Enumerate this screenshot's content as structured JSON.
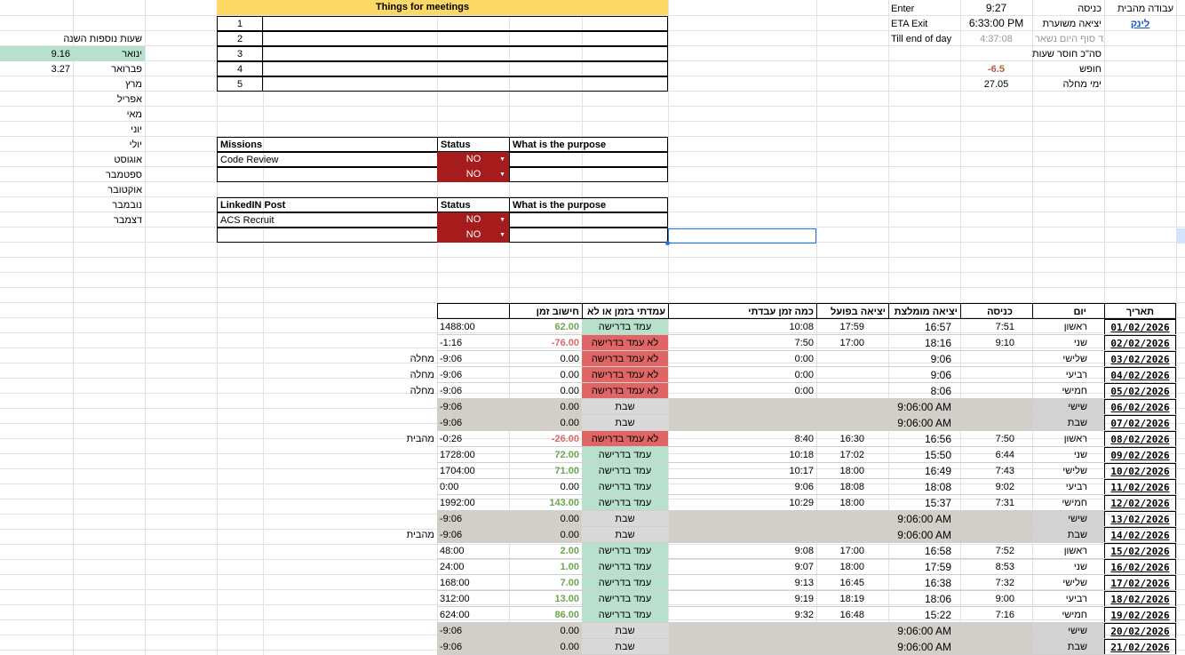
{
  "top_right": {
    "title": "עבודה מהבית",
    "link": "לינק",
    "labels": [
      "כניסה",
      "יציאה משוערת",
      "עד סוף היום נשאר",
      "סה\"כ חוסר שעות",
      "חופש",
      "ימי מחלה"
    ],
    "values": [
      "9:27",
      "6:33:00 PM",
      "4:37:08",
      "",
      "-6.5",
      "27.05"
    ],
    "english": [
      "Enter",
      "ETA Exit",
      "Till end of day"
    ]
  },
  "extra_hours": {
    "title": "שעות נוספות השנה",
    "months": [
      "ינואר",
      "פברואר",
      "מרץ",
      "אפריל",
      "מאי",
      "יוני",
      "יולי",
      "אוגוסט",
      "ספטמבר",
      "אוקטובר",
      "נובמבר",
      "דצמבר"
    ],
    "values": [
      "9.16",
      "3.27",
      "",
      "",
      "",
      "",
      "",
      "",
      "",
      "",
      "",
      ""
    ]
  },
  "meetings": {
    "title": "Things for meetings",
    "numbers": [
      "1",
      "2",
      "3",
      "4",
      "5"
    ]
  },
  "missions": {
    "headers": [
      "Missions",
      "Status",
      "What is the purpose"
    ],
    "rows": [
      {
        "name": "Code Review",
        "status": "NO"
      },
      {
        "name": "",
        "status": "NO"
      }
    ]
  },
  "linkedin": {
    "headers": [
      "LinkedIN Post",
      "Status",
      "What is the purpose"
    ],
    "rows": [
      {
        "name": "ACS Recruit",
        "status": "NO"
      },
      {
        "name": "",
        "status": "NO"
      }
    ]
  },
  "log": {
    "headers": [
      "תאריך",
      "יום",
      "כניסה",
      "יציאה מומלצת",
      "יציאה בפועל",
      "כמה זמן עבדתי",
      "עמדתי בזמן או לא",
      "חישוב זמן",
      ""
    ],
    "rows": [
      {
        "date": "01/02/2026",
        "day": "ראשון",
        "enter": "7:51",
        "rec": "16:57",
        "actual": "17:59",
        "worked": "10:08",
        "status": "עמד בדרישה",
        "calc": "62.00",
        "total": "1488:00",
        "note": "",
        "type": "ok"
      },
      {
        "date": "02/02/2026",
        "day": "שני",
        "enter": "9:10",
        "rec": "18:16",
        "actual": "17:00",
        "worked": "7:50",
        "status": "לא עמד בדרישה",
        "calc": "-76.00",
        "total": "-1:16",
        "note": "",
        "type": "bad"
      },
      {
        "date": "03/02/2026",
        "day": "שלישי",
        "enter": "",
        "rec": "9:06",
        "actual": "",
        "worked": "0:00",
        "status": "לא עמד בדרישה",
        "calc": "0.00",
        "total": "-9:06",
        "note": "מחלה",
        "type": "bad"
      },
      {
        "date": "04/02/2026",
        "day": "רביעי",
        "enter": "",
        "rec": "9:06",
        "actual": "",
        "worked": "0:00",
        "status": "לא עמד בדרישה",
        "calc": "0.00",
        "total": "-9:06",
        "note": "מחלה",
        "type": "bad"
      },
      {
        "date": "05/02/2026",
        "day": "חמישי",
        "enter": "",
        "rec": "8:06",
        "actual": "",
        "worked": "0:00",
        "status": "לא עמד בדרישה",
        "calc": "0.00",
        "total": "-9:06",
        "note": "מחלה",
        "type": "bad"
      },
      {
        "date": "06/02/2026",
        "day": "שישי",
        "enter": "",
        "rec": "9:06:00 AM",
        "actual": "",
        "worked": "",
        "status": "שבת",
        "calc": "0.00",
        "total": "-9:06",
        "note": "",
        "type": "weekend"
      },
      {
        "date": "07/02/2026",
        "day": "שבת",
        "enter": "",
        "rec": "9:06:00 AM",
        "actual": "",
        "worked": "",
        "status": "שבת",
        "calc": "0.00",
        "total": "-9:06",
        "note": "",
        "type": "weekend"
      },
      {
        "date": "08/02/2026",
        "day": "ראשון",
        "enter": "7:50",
        "rec": "16:56",
        "actual": "16:30",
        "worked": "8:40",
        "status": "לא עמד בדרישה",
        "calc": "-26.00",
        "total": "-0:26",
        "note": "מהבית",
        "type": "bad"
      },
      {
        "date": "09/02/2026",
        "day": "שני",
        "enter": "6:44",
        "rec": "15:50",
        "actual": "17:02",
        "worked": "10:18",
        "status": "עמד בדרישה",
        "calc": "72.00",
        "total": "1728:00",
        "note": "",
        "type": "ok"
      },
      {
        "date": "10/02/2026",
        "day": "שלישי",
        "enter": "7:43",
        "rec": "16:49",
        "actual": "18:00",
        "worked": "10:17",
        "status": "עמד בדרישה",
        "calc": "71.00",
        "total": "1704:00",
        "note": "",
        "type": "ok"
      },
      {
        "date": "11/02/2026",
        "day": "רביעי",
        "enter": "9:02",
        "rec": "18:08",
        "actual": "18:08",
        "worked": "9:06",
        "status": "עמד בדרישה",
        "calc": "0.00",
        "total": "0:00",
        "note": "",
        "type": "ok0"
      },
      {
        "date": "12/02/2026",
        "day": "חמישי",
        "enter": "7:31",
        "rec": "15:37",
        "actual": "18:00",
        "worked": "10:29",
        "status": "עמד בדרישה",
        "calc": "143.00",
        "total": "1992:00",
        "note": "",
        "type": "ok"
      },
      {
        "date": "13/02/2026",
        "day": "שישי",
        "enter": "",
        "rec": "9:06:00 AM",
        "actual": "",
        "worked": "",
        "status": "שבת",
        "calc": "0.00",
        "total": "-9:06",
        "note": "",
        "type": "weekend"
      },
      {
        "date": "14/02/2026",
        "day": "שבת",
        "enter": "",
        "rec": "9:06:00 AM",
        "actual": "",
        "worked": "",
        "status": "שבת",
        "calc": "0.00",
        "total": "-9:06",
        "note": "מהבית",
        "type": "weekend"
      },
      {
        "date": "15/02/2026",
        "day": "ראשון",
        "enter": "7:52",
        "rec": "16:58",
        "actual": "17:00",
        "worked": "9:08",
        "status": "עמד בדרישה",
        "calc": "2.00",
        "total": "48:00",
        "note": "",
        "type": "ok"
      },
      {
        "date": "16/02/2026",
        "day": "שני",
        "enter": "8:53",
        "rec": "17:59",
        "actual": "18:00",
        "worked": "9:07",
        "status": "עמד בדרישה",
        "calc": "1.00",
        "total": "24:00",
        "note": "",
        "type": "ok"
      },
      {
        "date": "17/02/2026",
        "day": "שלישי",
        "enter": "7:32",
        "rec": "16:38",
        "actual": "16:45",
        "worked": "9:13",
        "status": "עמד בדרישה",
        "calc": "7.00",
        "total": "168:00",
        "note": "",
        "type": "ok"
      },
      {
        "date": "18/02/2026",
        "day": "רביעי",
        "enter": "9:00",
        "rec": "18:06",
        "actual": "18:19",
        "worked": "9:19",
        "status": "עמד בדרישה",
        "calc": "13.00",
        "total": "312:00",
        "note": "",
        "type": "ok"
      },
      {
        "date": "19/02/2026",
        "day": "חמישי",
        "enter": "7:16",
        "rec": "15:22",
        "actual": "16:48",
        "worked": "9:32",
        "status": "עמד בדרישה",
        "calc": "86.00",
        "total": "624:00",
        "note": "",
        "type": "ok"
      },
      {
        "date": "20/02/2026",
        "day": "שישי",
        "enter": "",
        "rec": "9:06:00 AM",
        "actual": "",
        "worked": "",
        "status": "שבת",
        "calc": "0.00",
        "total": "-9:06",
        "note": "",
        "type": "weekend"
      },
      {
        "date": "21/02/2026",
        "day": "שבת",
        "enter": "",
        "rec": "9:06:00 AM",
        "actual": "",
        "worked": "",
        "status": "שבת",
        "calc": "0.00",
        "total": "-9:06",
        "note": "",
        "type": "weekend"
      }
    ]
  }
}
